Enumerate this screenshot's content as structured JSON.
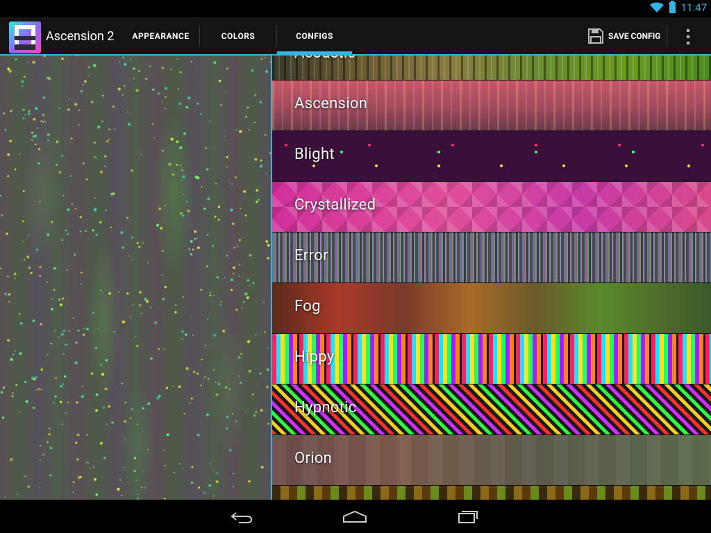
{
  "status_bar": {
    "time": "11:47"
  },
  "action_bar": {
    "app_title": "Ascension 2",
    "tabs": [
      {
        "label": "APPEARANCE"
      },
      {
        "label": "COLORS"
      },
      {
        "label": "CONFIGS"
      }
    ],
    "selected_tab": "CONFIGS",
    "save_label": "SAVE CONFIG"
  },
  "configs": [
    {
      "label": "Acoustic"
    },
    {
      "label": "Ascension"
    },
    {
      "label": "Blight"
    },
    {
      "label": "Crystallized"
    },
    {
      "label": "Error"
    },
    {
      "label": "Fog"
    },
    {
      "label": "Hippy"
    },
    {
      "label": "Hypnotic"
    },
    {
      "label": "Orion"
    }
  ],
  "colors": {
    "accent": "#33b5e5",
    "action_bar_bg": "#141414",
    "status_bar_bg": "#000000"
  },
  "icons": {
    "status": [
      "wifi-icon",
      "battery-icon"
    ],
    "save": "floppy-disk-icon",
    "overflow": "overflow-menu-icon",
    "nav": [
      "back-icon",
      "home-icon",
      "recent-apps-icon"
    ]
  }
}
